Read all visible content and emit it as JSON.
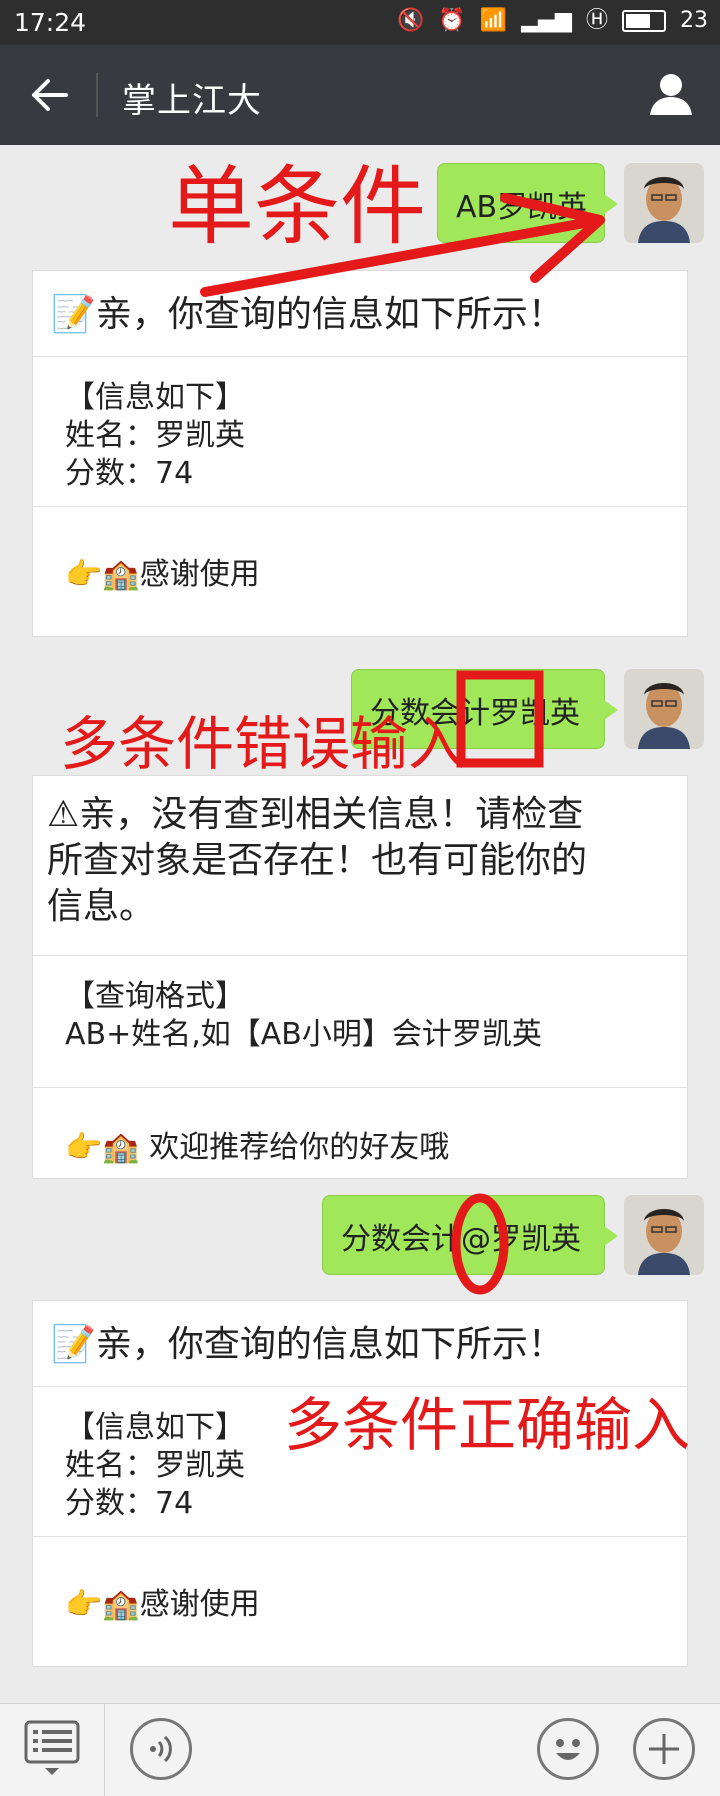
{
  "status_bar": {
    "time": "17:24",
    "battery": "23"
  },
  "header": {
    "title": "掌上江大"
  },
  "messages": [
    {
      "text": "AB罗凯英"
    },
    {
      "text": "分数会计罗凯英"
    },
    {
      "text": "分数会计@罗凯英"
    }
  ],
  "cards": [
    {
      "title": "亲，你查询的信息如下所示！",
      "body_lines": [
        "【信息如下】",
        "姓名：罗凯英",
        "分数：74"
      ],
      "footer": "感谢使用"
    },
    {
      "title": "亲，没有查到相关信息！请检查所查对象是否存在！也有可能你的信息。",
      "title_lines": [
        "亲，没有查到相关信息！请检查",
        "所查对象是否存在！也有可能你的",
        "信息。"
      ],
      "body_lines": [
        "【查询格式】",
        "AB+姓名,如【AB小明】会计罗凯英"
      ],
      "footer": "欢迎推荐给你的好友哦"
    },
    {
      "title": "亲，你查询的信息如下所示！",
      "body_lines": [
        "【信息如下】",
        "姓名：罗凯英",
        "分数：74"
      ],
      "footer": "感谢使用"
    }
  ],
  "annotations": {
    "single": "单条件",
    "multi_wrong": "多条件错误输入",
    "multi_right": "多条件正确输入"
  },
  "icons": {
    "back": "back-arrow-icon",
    "user": "user-icon",
    "menu": "menu-list-icon",
    "voice": "voice-icon",
    "emoji": "emoji-icon",
    "plus": "plus-icon"
  },
  "colors": {
    "bubble": "#a0e75a",
    "annotation": "#e41a1a",
    "header": "#393a3f"
  }
}
